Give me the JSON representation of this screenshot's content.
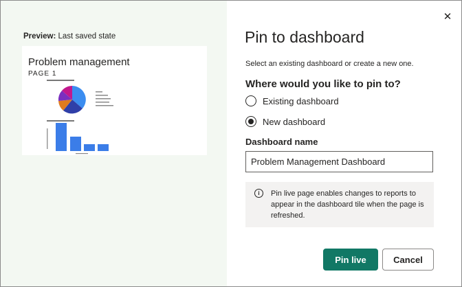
{
  "preview": {
    "label_bold": "Preview:",
    "label_rest": "Last saved state",
    "thumbnail": {
      "title": "Problem management",
      "page": "PAGE 1",
      "pie_chart": {
        "type": "pie",
        "colors": [
          "#2f3fa8",
          "#7b2fbf",
          "#c2188d",
          "#e07b1f",
          "#3b8df0"
        ]
      },
      "bar_chart": {
        "type": "bar",
        "values": [
          100,
          52,
          24,
          24
        ],
        "color": "#3b7de8"
      }
    }
  },
  "dialog": {
    "close_icon": "close-icon",
    "title": "Pin to dashboard",
    "subtitle": "Select an existing dashboard or create a new one.",
    "question": "Where would you like to pin to?",
    "options": [
      {
        "label": "Existing dashboard",
        "checked": false
      },
      {
        "label": "New dashboard",
        "checked": true
      }
    ],
    "dashboard_name_label": "Dashboard name",
    "dashboard_name_value": "Problem Management Dashboard",
    "info_text": "Pin live page enables changes to reports to appear in the dashboard tile when the page is refreshed.",
    "info_icon": "info-icon",
    "primary_button": "Pin live",
    "secondary_button": "Cancel"
  },
  "colors": {
    "accent": "#117865",
    "left_panel_bg": "#f3f8f2",
    "info_bg": "#f3f2f1"
  }
}
